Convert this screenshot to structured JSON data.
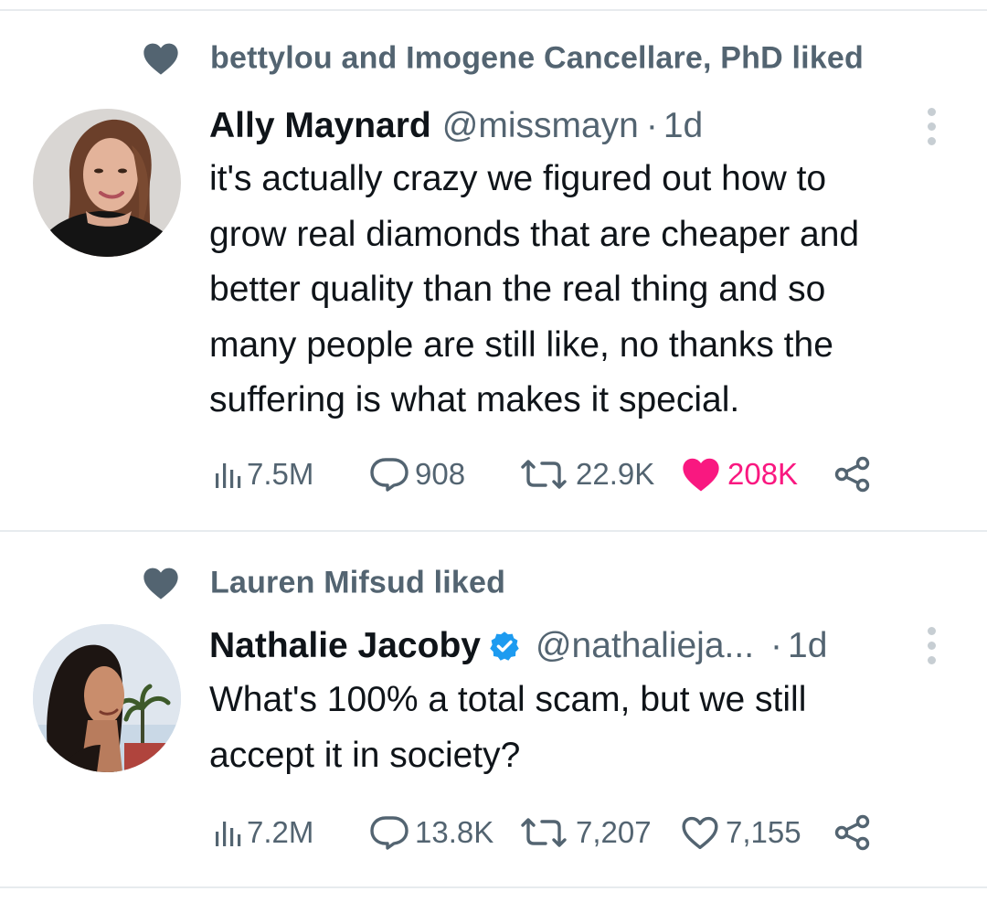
{
  "tweets": [
    {
      "social_context": "bettylou and Imogene Cancellare, PhD liked",
      "author": {
        "name": "Ally Maynard",
        "handle": "@missmayn",
        "verified": false
      },
      "separator": "·",
      "time": "1d",
      "text_lines": [
        "it's actually crazy we figured out how to",
        "grow real diamonds that are cheaper and",
        "better quality than the real thing and so",
        "many people are still like, no thanks the",
        "suffering is what makes it special."
      ],
      "stats": {
        "views": "7.5M",
        "replies": "908",
        "retweets": "22.9K",
        "likes": "208K"
      },
      "liked_by_viewer": true
    },
    {
      "social_context": "Lauren Mifsud liked",
      "author": {
        "name": "Nathalie Jacoby",
        "handle": "@nathalieja...",
        "verified": true
      },
      "separator": "·",
      "time": "1d",
      "text_lines": [
        "What's 100% a total scam, but we still",
        "accept it in society?"
      ],
      "stats": {
        "views": "7.2M",
        "replies": "13.8K",
        "retweets": "7,207",
        "likes": "7,155"
      },
      "liked_by_viewer": false
    }
  ],
  "icons": {
    "social_context": "heart-icon",
    "more": "more-vertical-icon",
    "views": "analytics-icon",
    "replies": "reply-icon",
    "retweets": "retweet-icon",
    "likes": "heart-icon",
    "share": "share-icon",
    "verified": "verified-badge-icon"
  },
  "colors": {
    "text_primary": "#0f1419",
    "text_secondary": "#536471",
    "like_active": "#f91880",
    "verified_blue": "#1d9bf0",
    "divider": "#e7ebee"
  }
}
